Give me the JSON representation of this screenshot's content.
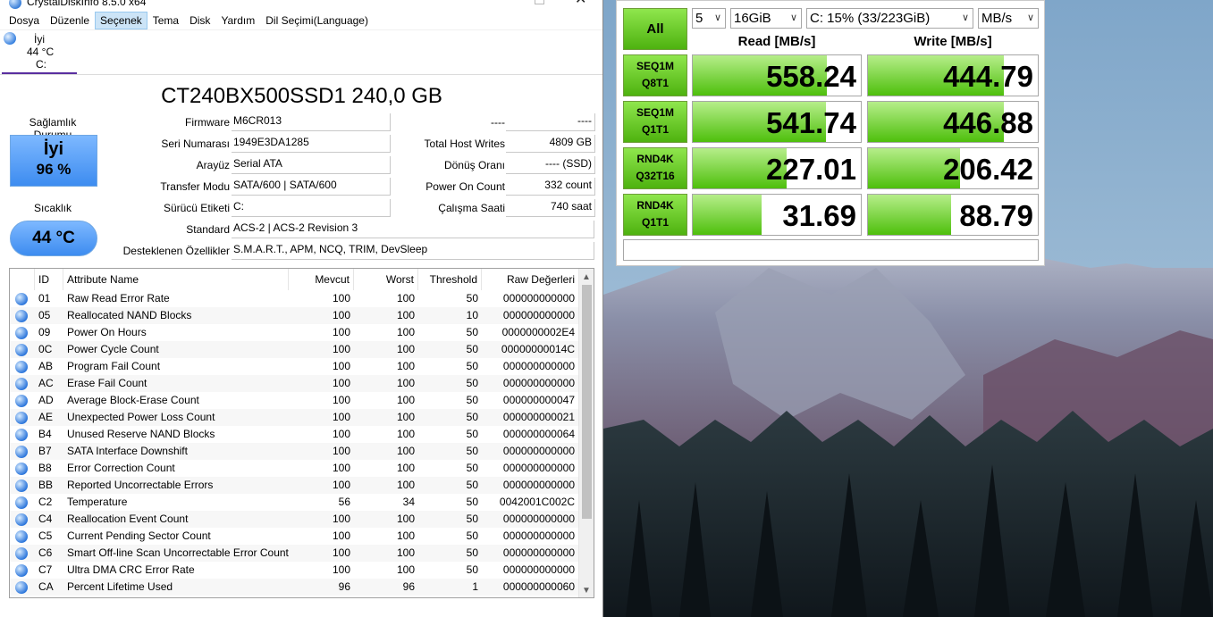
{
  "cdi": {
    "title": "CrystalDiskInfo 8.5.0 x64",
    "menu": [
      "Dosya",
      "Düzenle",
      "Seçenek",
      "Tema",
      "Disk",
      "Yardım",
      "Dil Seçimi(Language)"
    ],
    "drive_tab": {
      "status": "İyi",
      "temp": "44 °C",
      "letter": "C:"
    },
    "model": "CT240BX500SSD1 240,0 GB",
    "health": {
      "label": "Sağlamlık Durumu",
      "status": "İyi",
      "percent": "96 %"
    },
    "temperature": {
      "label": "Sıcaklık",
      "value": "44 °C"
    },
    "info_left": [
      {
        "label": "Firmware",
        "value": "M6CR013"
      },
      {
        "label": "Seri Numarası",
        "value": "1949E3DA1285"
      },
      {
        "label": "Arayüz",
        "value": "Serial ATA"
      },
      {
        "label": "Transfer Modu",
        "value": "SATA/600 | SATA/600"
      },
      {
        "label": "Sürücü Etiketi",
        "value": "C:"
      }
    ],
    "info_right": [
      {
        "label": "----",
        "value": "----"
      },
      {
        "label": "Total Host Writes",
        "value": "4809 GB"
      },
      {
        "label": "Dönüş Oranı",
        "value": "---- (SSD)"
      },
      {
        "label": "Power On Count",
        "value": "332 count"
      },
      {
        "label": "Çalışma Saati",
        "value": "740 saat"
      }
    ],
    "standard": {
      "label": "Standard",
      "value": "ACS-2 | ACS-2 Revision 3"
    },
    "features": {
      "label": "Desteklenen Özellikler",
      "value": "S.M.A.R.T., APM, NCQ, TRIM, DevSleep"
    },
    "smart_headers": [
      "ID",
      "Attribute Name",
      "Mevcut",
      "Worst",
      "Threshold",
      "Raw Değerleri"
    ],
    "smart_rows": [
      [
        "01",
        "Raw Read Error Rate",
        "100",
        "100",
        "50",
        "000000000000"
      ],
      [
        "05",
        "Reallocated NAND Blocks",
        "100",
        "100",
        "10",
        "000000000000"
      ],
      [
        "09",
        "Power On Hours",
        "100",
        "100",
        "50",
        "0000000002E4"
      ],
      [
        "0C",
        "Power Cycle Count",
        "100",
        "100",
        "50",
        "00000000014C"
      ],
      [
        "AB",
        "Program Fail Count",
        "100",
        "100",
        "50",
        "000000000000"
      ],
      [
        "AC",
        "Erase Fail Count",
        "100",
        "100",
        "50",
        "000000000000"
      ],
      [
        "AD",
        "Average Block-Erase Count",
        "100",
        "100",
        "50",
        "000000000047"
      ],
      [
        "AE",
        "Unexpected Power Loss Count",
        "100",
        "100",
        "50",
        "000000000021"
      ],
      [
        "B4",
        "Unused Reserve NAND Blocks",
        "100",
        "100",
        "50",
        "000000000064"
      ],
      [
        "B7",
        "SATA Interface Downshift",
        "100",
        "100",
        "50",
        "000000000000"
      ],
      [
        "B8",
        "Error Correction Count",
        "100",
        "100",
        "50",
        "000000000000"
      ],
      [
        "BB",
        "Reported Uncorrectable Errors",
        "100",
        "100",
        "50",
        "000000000000"
      ],
      [
        "C2",
        "Temperature",
        "56",
        "34",
        "50",
        "0042001C002C"
      ],
      [
        "C4",
        "Reallocation Event Count",
        "100",
        "100",
        "50",
        "000000000000"
      ],
      [
        "C5",
        "Current Pending Sector Count",
        "100",
        "100",
        "50",
        "000000000000"
      ],
      [
        "C6",
        "Smart Off-line Scan Uncorrectable Error Count",
        "100",
        "100",
        "50",
        "000000000000"
      ],
      [
        "C7",
        "Ultra DMA CRC Error Rate",
        "100",
        "100",
        "50",
        "000000000000"
      ],
      [
        "CA",
        "Percent Lifetime Used",
        "96",
        "96",
        "1",
        "000000000060"
      ]
    ],
    "scroll_position": 0.0
  },
  "cdm": {
    "all_label": "All",
    "count": "5",
    "size": "16GiB",
    "drive": "C: 15% (33/223GiB)",
    "unit": "MB/s",
    "read_header": "Read [MB/s]",
    "write_header": "Write [MB/s]",
    "tests": [
      {
        "line1": "SEQ1M",
        "line2": "Q8T1",
        "read": "558.24",
        "write": "444.79",
        "read_fill": 0.8,
        "write_fill": 0.8
      },
      {
        "line1": "SEQ1M",
        "line2": "Q1T1",
        "read": "541.74",
        "write": "446.88",
        "read_fill": 0.79,
        "write_fill": 0.8
      },
      {
        "line1": "RND4K",
        "line2": "Q32T16",
        "read": "227.01",
        "write": "206.42",
        "read_fill": 0.56,
        "write_fill": 0.54
      },
      {
        "line1": "RND4K",
        "line2": "Q1T1",
        "read": "31.69",
        "write": "88.79",
        "read_fill": 0.41,
        "write_fill": 0.49
      }
    ],
    "comment": ""
  }
}
